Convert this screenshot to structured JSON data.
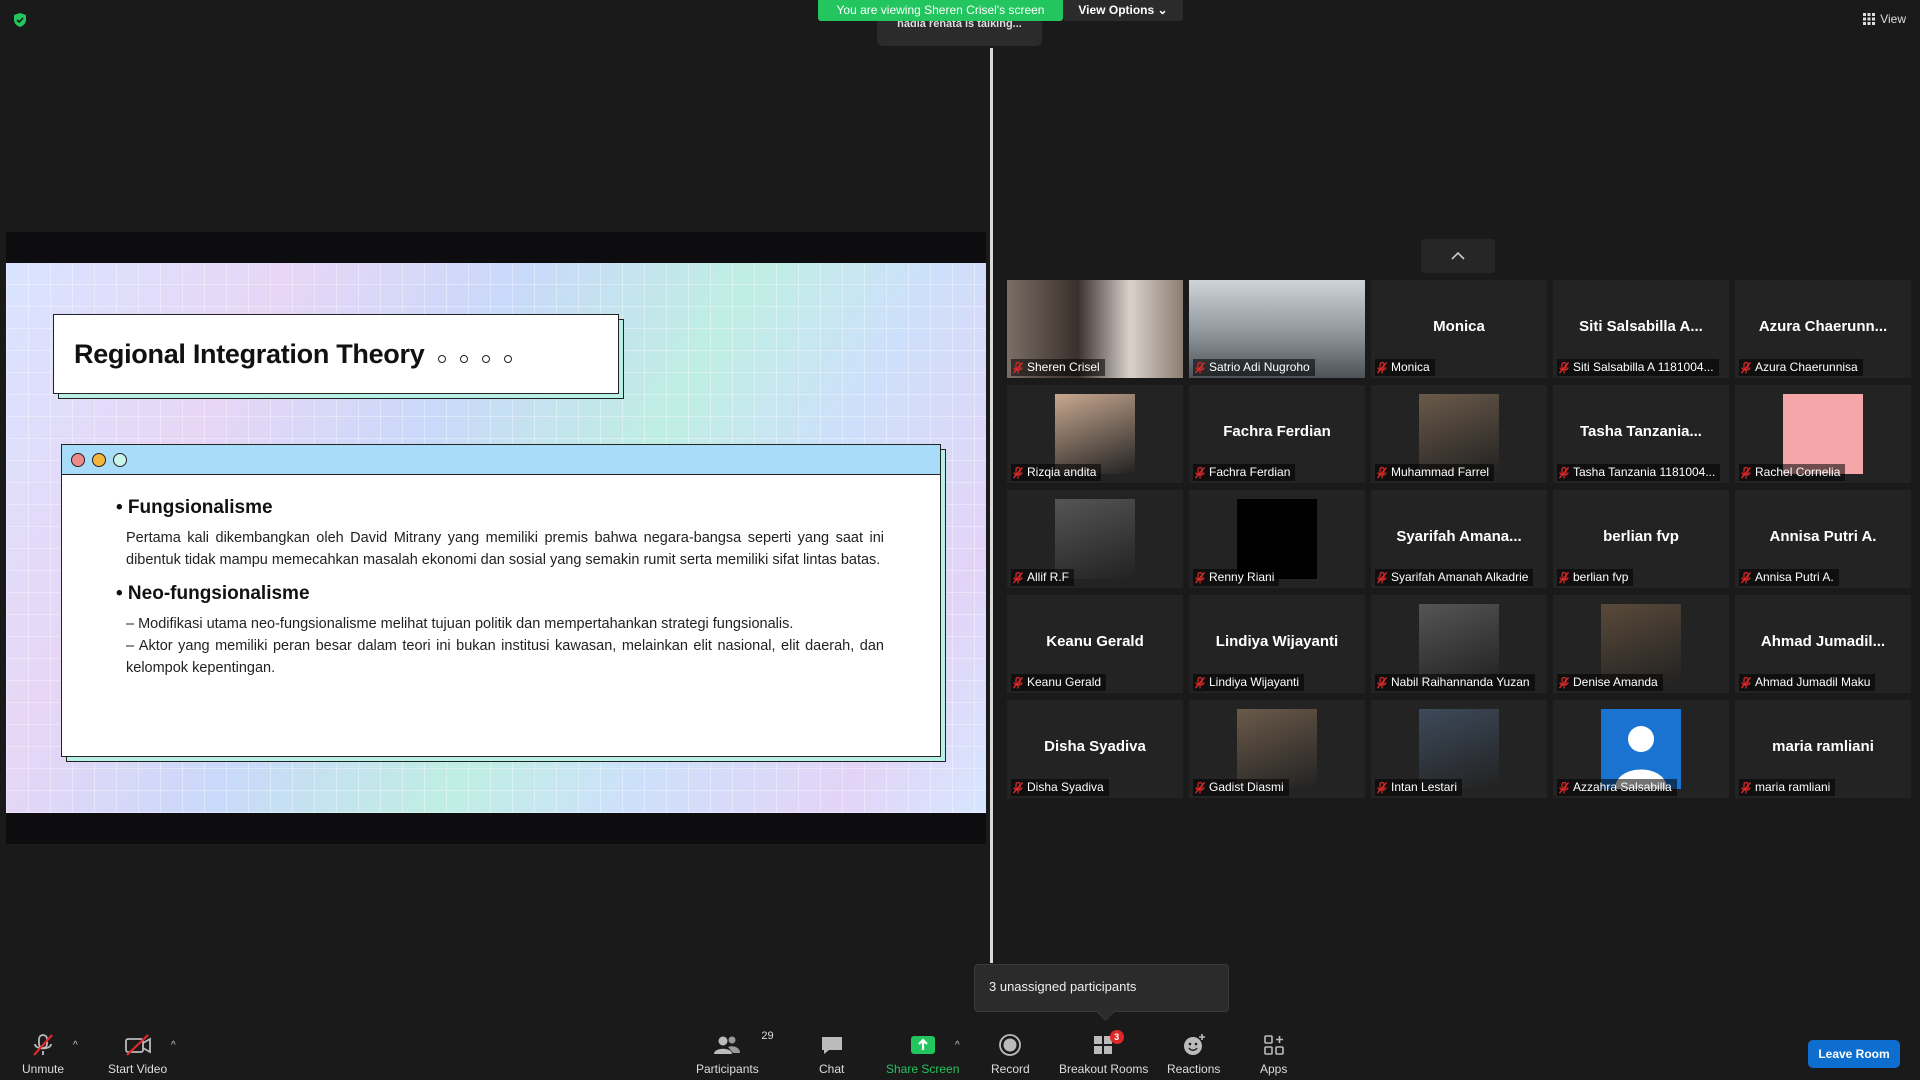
{
  "banner": {
    "viewing": "You are viewing Sheren Crisel's screen",
    "view_options": "View Options",
    "talking": "nadia renata is talking...",
    "view": "View"
  },
  "slide": {
    "title": "Regional Integration Theory",
    "section1_title": "• Fungsionalisme",
    "section1_text": "Pertama kali dikembangkan oleh David Mitrany yang memiliki premis bahwa negara-bangsa seperti yang saat ini dibentuk tidak mampu memecahkan masalah ekonomi dan sosial yang semakin rumit serta memiliki sifat lintas batas.",
    "section2_title": "• Neo-fungsionalisme",
    "section2_text1": "– Modifikasi utama neo-fungsionalisme melihat tujuan politik dan mempertahankan strategi fungsionalis.",
    "section2_text2": "– Aktor yang memiliki peran besar dalam teori ini bukan institusi kawasan, melainkan elit nasional, elit daerah, dan kelompok kepentingan."
  },
  "participants": [
    {
      "label": "Sheren Crisel",
      "big": "",
      "kind": "video"
    },
    {
      "label": "Satrio Adi Nugroho",
      "big": "",
      "kind": "video"
    },
    {
      "label": "Monica",
      "big": "Monica",
      "kind": "name"
    },
    {
      "label": "Siti Salsabilla A 1181004...",
      "big": "Siti  Salsabilla  A...",
      "kind": "name"
    },
    {
      "label": "Azura Chaerunnisa",
      "big": "Azura  Chaerunn...",
      "kind": "name"
    },
    {
      "label": "Rizqia andita",
      "big": "",
      "kind": "photo"
    },
    {
      "label": "Fachra Ferdian",
      "big": "Fachra Ferdian",
      "kind": "name"
    },
    {
      "label": "Muhammad Farrel",
      "big": "",
      "kind": "photo"
    },
    {
      "label": "Tasha Tanzania 1181004...",
      "big": "Tasha  Tanzania...",
      "kind": "name"
    },
    {
      "label": "Rachel Cornelia",
      "big": "",
      "kind": "pink"
    },
    {
      "label": "Allif R.F",
      "big": "",
      "kind": "photo"
    },
    {
      "label": "Renny Riani",
      "big": "",
      "kind": "black"
    },
    {
      "label": "Syarifah Amanah Alkadrie",
      "big": "Syarifah  Amana...",
      "kind": "name"
    },
    {
      "label": "berlian fvp",
      "big": "berlian fvp",
      "kind": "name"
    },
    {
      "label": "Annisa Putri A.",
      "big": "Annisa Putri A.",
      "kind": "name"
    },
    {
      "label": "Keanu Gerald",
      "big": "Keanu Gerald",
      "kind": "name"
    },
    {
      "label": "Lindiya Wijayanti",
      "big": "Lindiya Wijayanti",
      "kind": "name"
    },
    {
      "label": "Nabil Raihannanda Yuzan",
      "big": "",
      "kind": "photo"
    },
    {
      "label": "Denise Amanda",
      "big": "",
      "kind": "photo"
    },
    {
      "label": "Ahmad Jumadil Maku",
      "big": "Ahmad  Jumadil...",
      "kind": "name"
    },
    {
      "label": "Disha Syadiva",
      "big": "Disha Syadiva",
      "kind": "name"
    },
    {
      "label": "Gadist Diasmi",
      "big": "",
      "kind": "photo"
    },
    {
      "label": "Intan Lestari",
      "big": "",
      "kind": "photo"
    },
    {
      "label": "Azzahra Salsabilla",
      "big": "",
      "kind": "avatar"
    },
    {
      "label": "maria ramliani",
      "big": "maria ramliani",
      "kind": "name"
    }
  ],
  "tooltip": "3 unassigned participants",
  "toolbar": {
    "unmute": "Unmute",
    "start_video": "Start Video",
    "participants": "Participants",
    "participants_count": "29",
    "chat": "Chat",
    "share_screen": "Share Screen",
    "record": "Record",
    "breakout_rooms": "Breakout Rooms",
    "breakout_badge": "3",
    "reactions": "Reactions",
    "apps": "Apps",
    "leave": "Leave Room"
  },
  "colors": {
    "share_green": "#22c55e",
    "leave_blue": "#0e6ecf",
    "mic_red": "#e02828"
  }
}
